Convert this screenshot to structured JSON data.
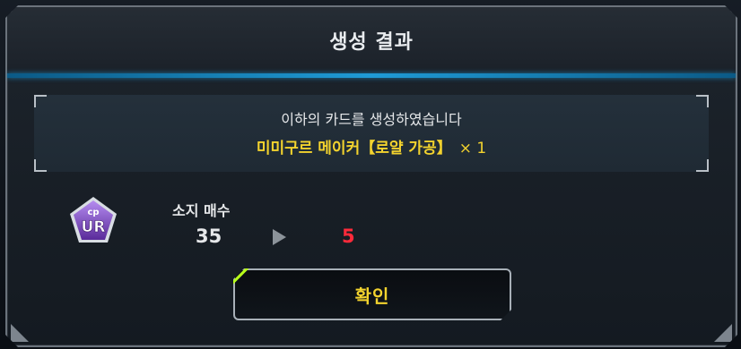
{
  "dialog": {
    "title": "생성 결과",
    "message": "이하의 카드를 생성하였습니다",
    "card_name": "미미구르 메이커【로얄 가공】",
    "card_quantity": "× 1"
  },
  "ownership": {
    "label": "소지 매수",
    "before": "35",
    "after": "5",
    "rarity_badge_text": "UR",
    "rarity_badge_prefix": "cp"
  },
  "buttons": {
    "confirm_label": "확인"
  },
  "colors": {
    "accent_blue": "#1f9bd6",
    "highlight_yellow": "#f3d32e",
    "after_red": "#ff2a3a",
    "badge_purple": "#7a3fb8",
    "button_accent": "#b7ff1a"
  }
}
